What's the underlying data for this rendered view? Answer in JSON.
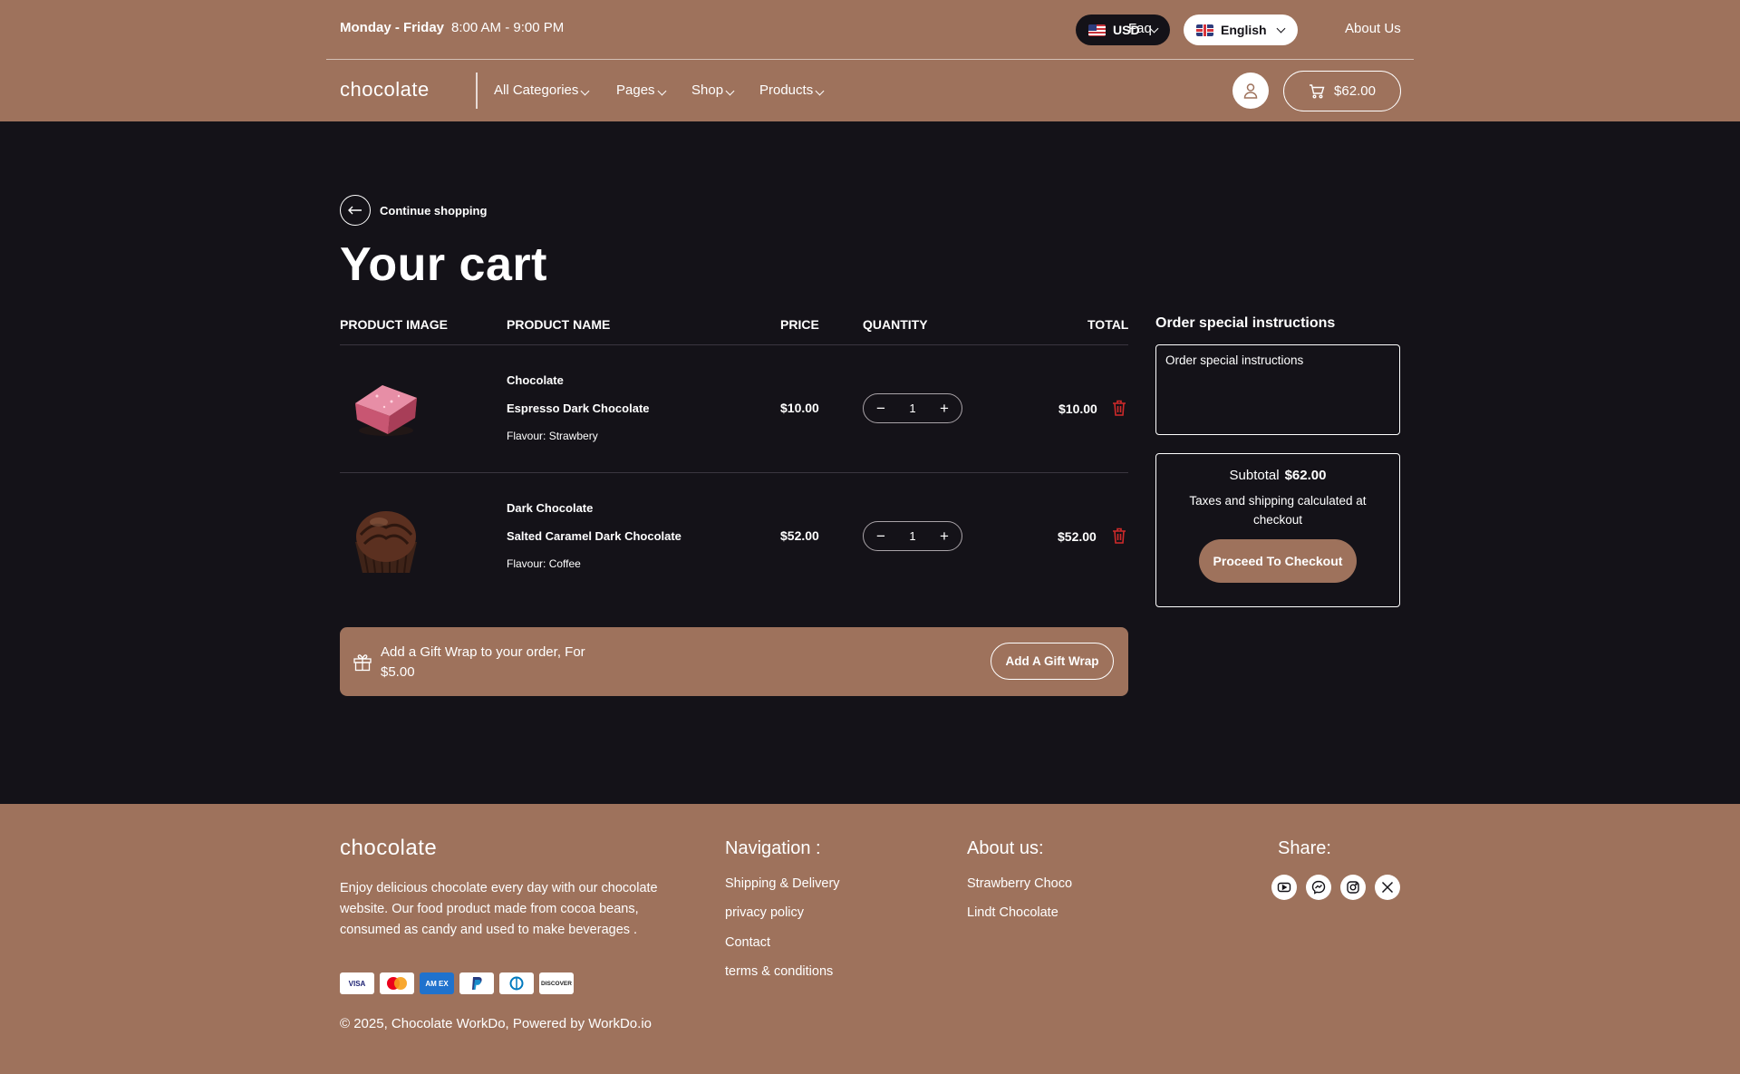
{
  "topbar": {
    "days": "Monday - Friday",
    "hours": "8:00 AM - 9:00 PM",
    "currency": "USD",
    "language": "English",
    "links": [
      "Faq",
      "About Us"
    ]
  },
  "nav": {
    "logo": "chocolate",
    "items": [
      "All Categories",
      "Pages",
      "Shop",
      "Products"
    ],
    "cart_total": "$62.00"
  },
  "cart": {
    "continue_label": "Continue shopping",
    "title": "Your cart",
    "headers": [
      "PRODUCT IMAGE",
      "PRODUCT NAME",
      "PRICE",
      "QUANTITY",
      "TOTAL"
    ],
    "items": [
      {
        "category": "Chocolate",
        "name": "Espresso Dark Chocolate",
        "flavour_label": "Flavour:",
        "flavour": "Strawbery",
        "price": "$10.00",
        "qty": "1",
        "total": "$10.00"
      },
      {
        "category": "Dark Chocolate",
        "name": "Salted Caramel Dark Chocolate",
        "flavour_label": "Flavour:",
        "flavour": "Coffee",
        "price": "$52.00",
        "qty": "1",
        "total": "$52.00"
      }
    ],
    "gift_text": "Add a Gift Wrap to your order, For $5.00",
    "gift_button": "Add A Gift Wrap"
  },
  "sidebar": {
    "instructions_title": "Order special instructions",
    "instructions_placeholder": "Order special instructions",
    "subtotal_label": "Subtotal",
    "subtotal_value": "$62.00",
    "taxes_note": "Taxes and shipping calculated at checkout",
    "checkout_button": "Proceed To Checkout"
  },
  "footer": {
    "logo": "chocolate",
    "description": "Enjoy delicious chocolate every day with our chocolate website. Our food product made from cocoa beans, consumed as candy and used to make beverages .",
    "payment_cards": [
      "VISA",
      "mastercard",
      "amex",
      "paypal",
      "diners",
      "DISCOVER"
    ],
    "copyright": "© 2025, Chocolate WorkDo, Powered by WorkDo.io",
    "navigation_title": "Navigation :",
    "navigation_links": [
      "Shipping & Delivery",
      "privacy policy",
      "Contact",
      "terms & conditions"
    ],
    "about_title": "About us:",
    "about_links": [
      "Strawberry Choco",
      "Lindt Chocolate"
    ],
    "share_title": "Share:",
    "social_icons": [
      "youtube-icon",
      "messenger-icon",
      "instagram-icon",
      "x-twitter-icon"
    ]
  },
  "colors": {
    "brand_brown": "#9e725c",
    "dark_bg": "#141218",
    "delete_red": "#d02a2a"
  }
}
